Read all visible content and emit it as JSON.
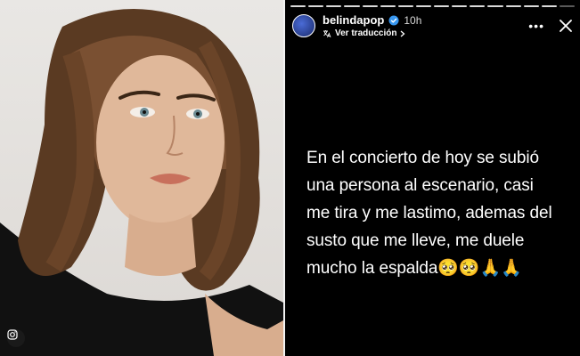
{
  "photo": {
    "subject": "portrait-photo",
    "corner_icon": "instagram-icon"
  },
  "story": {
    "username": "belindapop",
    "verified_icon": "verified-badge-icon",
    "time": "10h",
    "translate_label": "Ver traducción",
    "translate_icon": "chevron-right-icon",
    "more_label": "•••",
    "close_icon": "close-icon",
    "progress_segments": 16,
    "text_lines": [
      "En el concierto de hoy se subió",
      "una persona al escenario, casi",
      "me tira y me lastimo, ademas del",
      "susto que me lleve, me duele",
      "mucho la espalda🥺🥺🙏🙏"
    ]
  },
  "colors": {
    "background": "#000000",
    "text": "#ffffff",
    "photo_bg": "#e5e2df"
  }
}
